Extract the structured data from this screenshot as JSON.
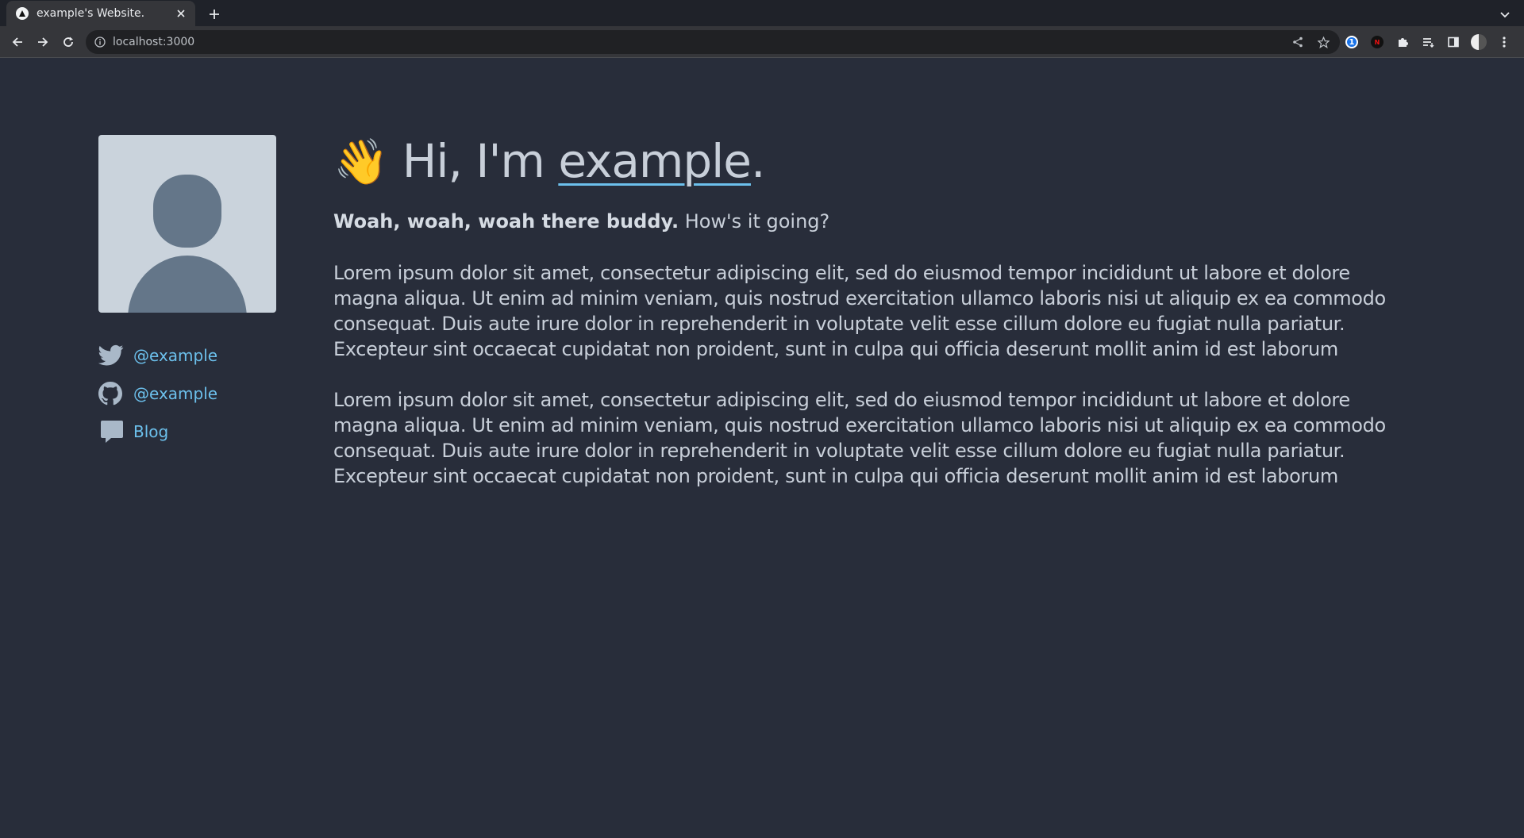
{
  "browser": {
    "tab_title": "example's Website.",
    "url": "localhost:3000"
  },
  "profile": {
    "name": "example",
    "greeting_prefix": "Hi, I'm ",
    "greeting_suffix": ".",
    "wave_emoji": "👋"
  },
  "social": [
    {
      "icon": "twitter-icon",
      "label": "@example"
    },
    {
      "icon": "github-icon",
      "label": "@example"
    },
    {
      "icon": "blog-icon",
      "label": "Blog"
    }
  ],
  "intro": {
    "bold": "Woah, woah, woah there buddy.",
    "rest": " How's it going?"
  },
  "paragraphs": [
    "Lorem ipsum dolor sit amet, consectetur adipiscing elit, sed do eiusmod tempor incididunt ut labore et dolore magna aliqua. Ut enim ad minim veniam, quis nostrud exercitation ullamco laboris nisi ut aliquip ex ea commodo consequat. Duis aute irure dolor in reprehenderit in voluptate velit esse cillum dolore eu fugiat nulla pariatur. Excepteur sint occaecat cupidatat non proident, sunt in culpa qui officia deserunt mollit anim id est laborum",
    "Lorem ipsum dolor sit amet, consectetur adipiscing elit, sed do eiusmod tempor incididunt ut labore et dolore magna aliqua. Ut enim ad minim veniam, quis nostrud exercitation ullamco laboris nisi ut aliquip ex ea commodo consequat. Duis aute irure dolor in reprehenderit in voluptate velit esse cillum dolore eu fugiat nulla pariatur. Excepteur sint occaecat cupidatat non proident, sunt in culpa qui officia deserunt mollit anim id est laborum"
  ],
  "colors": {
    "background": "#282d3a",
    "text": "#c8cfd9",
    "link": "#6cc0ec",
    "icon": "#a9b8c8"
  }
}
